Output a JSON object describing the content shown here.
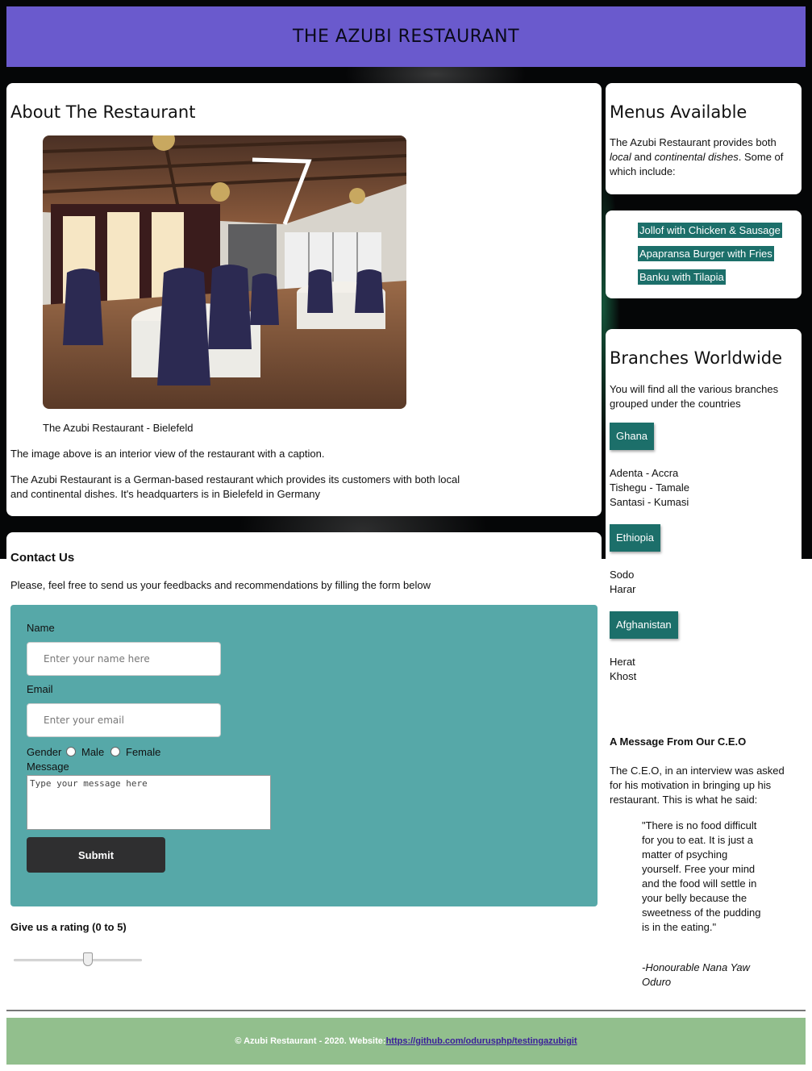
{
  "header": {
    "title": "THE AZUBI RESTAURANT"
  },
  "about": {
    "heading": "About The Restaurant",
    "caption": "The Azubi Restaurant - Bielefeld",
    "para1": "The image above is an interior view of the restaurant with a caption.",
    "para2": "The Azubi Restaurant is a German-based restaurant which provides its customers with both local and continental dishes. It's headquarters is in Bielefeld in Germany"
  },
  "menus": {
    "heading": "Menus Available",
    "intro_a": "The Azubi Restaurant provides both ",
    "intro_local": "local",
    "intro_b": " and ",
    "intro_continental": "continental dishes",
    "intro_c": ". Some of which include:",
    "items": [
      "Jollof with Chicken & Sausage",
      "Apapransa Burger with Fries",
      "Banku with Tilapia"
    ]
  },
  "branches": {
    "heading": "Branches Worldwide",
    "intro": "You will find all the various branches grouped under the countries",
    "countries": [
      {
        "name": "Ghana",
        "cities": [
          "Adenta - Accra",
          "Tishegu - Tamale",
          "Santasi - Kumasi"
        ]
      },
      {
        "name": "Ethiopia",
        "cities": [
          "Sodo",
          "Harar"
        ]
      },
      {
        "name": "Afghanistan",
        "cities": [
          "Herat",
          "Khost"
        ]
      }
    ]
  },
  "contact": {
    "heading": "Contact Us",
    "intro": "Please, feel free to send us your feedbacks and recommendations by filling the form below",
    "name_label": "Name",
    "name_placeholder": "Enter your name here",
    "email_label": "Email",
    "email_placeholder": "Enter your email",
    "gender_label": "Gender",
    "male_label": "Male",
    "female_label": "Female",
    "message_label": "Message",
    "message_placeholder": "Type your message here",
    "submit_label": "Submit"
  },
  "rating": {
    "label": "Give us a rating (0 to 5)",
    "min": 0,
    "max": 5,
    "value": 3
  },
  "ceo": {
    "heading": "A Message From Our C.E.O",
    "intro": "The C.E.O, in an interview was asked for his motivation in bringing up his restaurant. This is what he said:",
    "quote": "\"There is no food difficult for you to eat. It is just a matter of psyching yourself. Free your mind and the food will settle in your belly because the sweetness of the pudding is in the eating.\"",
    "signature": "-Honourable Nana Yaw Oduro"
  },
  "footer": {
    "text": "© Azubi Restaurant - 2020. Website: ",
    "link": "https://github.com/odurusphp/testingazubigit"
  },
  "colors": {
    "header": "#6a5acd",
    "accent": "#1c6f6a",
    "form": "#56a8a8",
    "footer": "#92bf8d"
  }
}
